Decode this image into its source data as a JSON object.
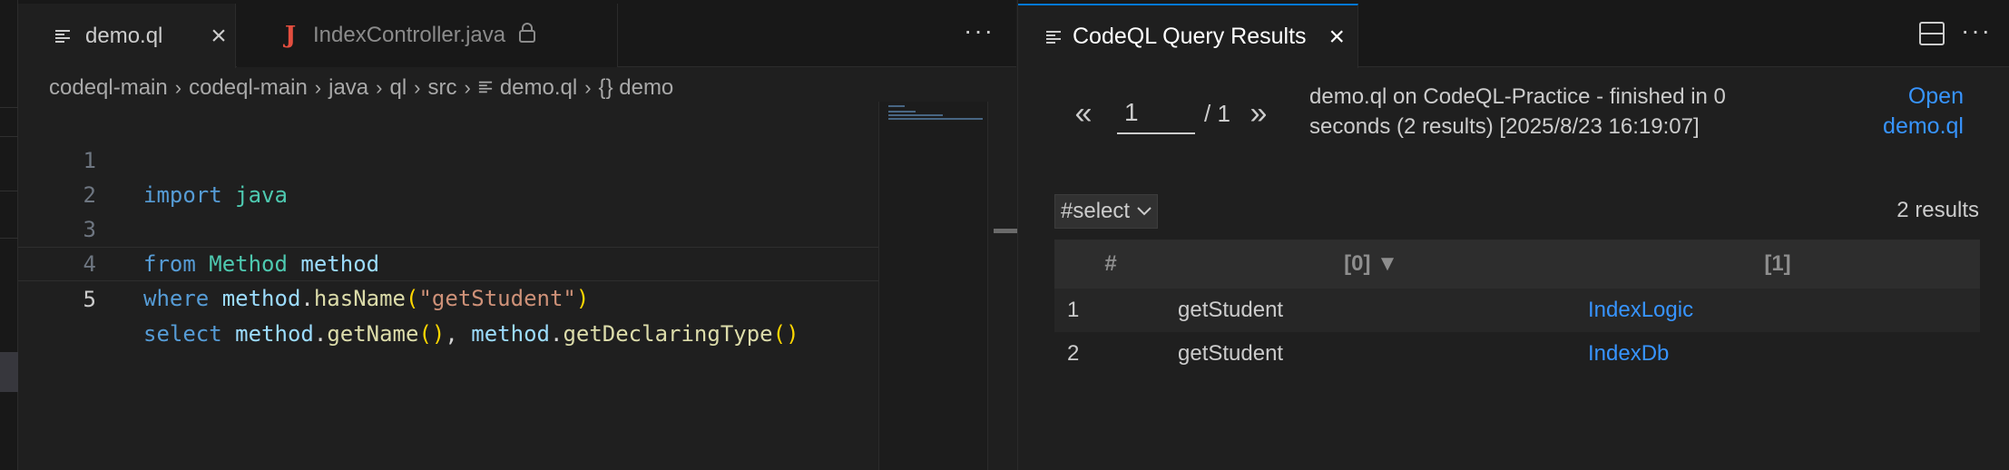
{
  "editor": {
    "tabs": [
      {
        "label": "demo.ql",
        "active": true
      },
      {
        "label": "IndexController.java",
        "active": false,
        "locked": true
      }
    ],
    "more_actions": "···",
    "breadcrumb": [
      "codeql-main",
      "codeql-main",
      "java",
      "ql",
      "src",
      "demo.ql",
      "{} demo"
    ],
    "lines": [
      {
        "number": "1",
        "text": "import java"
      },
      {
        "number": "2",
        "text": ""
      },
      {
        "number": "3",
        "text": "from Method method"
      },
      {
        "number": "4",
        "text": "where method.hasName(\"getStudent\")"
      },
      {
        "number": "5",
        "text": "select method.getName(), method.getDeclaringType()"
      }
    ]
  },
  "results_panel": {
    "tab_label": "CodeQL Query Results",
    "more_actions": "···",
    "pager": {
      "prev": "«",
      "page": "1",
      "total": "/ 1",
      "next": "»"
    },
    "status": "demo.ql on CodeQL-Practice - finished in 0 seconds (2 results) [2025/8/23 16:19:07]",
    "open_link": "Open demo.ql",
    "result_set": "#select",
    "result_count": "2 results",
    "columns": [
      "#",
      "[0] ▼",
      "[1]"
    ],
    "rows": [
      {
        "index": "1",
        "c0": "getStudent",
        "c1": "IndexLogic"
      },
      {
        "index": "2",
        "c0": "getStudent",
        "c1": "IndexDb"
      }
    ]
  },
  "colors": {
    "accent": "#0078d4",
    "link": "#3794ff",
    "keyword": "#569cd6",
    "type": "#4ec9b0",
    "string": "#ce9178",
    "function": "#dcdcaa"
  }
}
